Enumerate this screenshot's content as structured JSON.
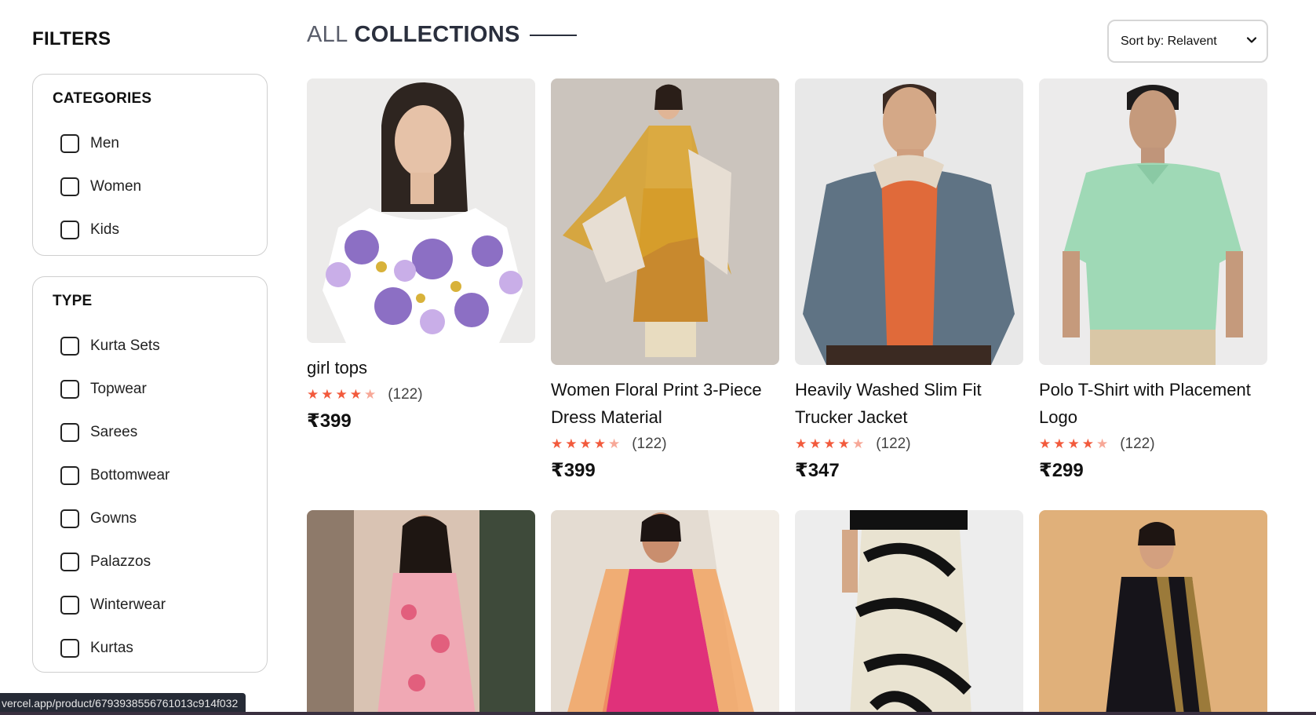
{
  "sidebar": {
    "title": "FILTERS",
    "categories": {
      "heading": "CATEGORIES",
      "options": [
        "Men",
        "Women",
        "Kids"
      ]
    },
    "type": {
      "heading": "TYPE",
      "options": [
        "Kurta Sets",
        "Topwear",
        "Sarees",
        "Bottomwear",
        "Gowns",
        "Palazzos",
        "Winterwear",
        "Kurtas"
      ]
    }
  },
  "header": {
    "title_part1": "ALL",
    "title_part2": "COLLECTIONS",
    "sort_label": "Sort by: Relavent"
  },
  "products": [
    {
      "name": "girl tops",
      "rating_count": "(122)",
      "price": "₹399",
      "stars": 4
    },
    {
      "name": "Women Floral Print 3-Piece Dress Material",
      "rating_count": "(122)",
      "price": "₹399",
      "stars": 4
    },
    {
      "name": "Heavily Washed Slim Fit Trucker Jacket",
      "rating_count": "(122)",
      "price": "₹347",
      "stars": 4
    },
    {
      "name": "Polo T-Shirt with Placement Logo",
      "rating_count": "(122)",
      "price": "₹299",
      "stars": 4
    }
  ],
  "status_url": "vercel.app/product/6793938556761013c914f032",
  "colors": {
    "star": "#f25a3c",
    "star_dim": "#f7a898",
    "title_dark": "#2a2f3d"
  }
}
